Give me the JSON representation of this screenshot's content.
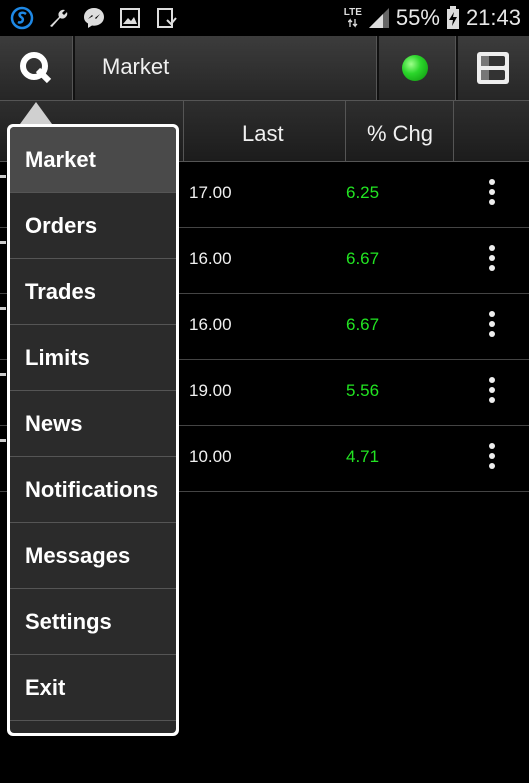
{
  "status_bar": {
    "network": "LTE",
    "battery": "55%",
    "time": "21:43",
    "left_icons": [
      "s-logo-icon",
      "wrench-icon",
      "messenger-icon",
      "gallery-icon",
      "download-icon"
    ]
  },
  "toolbar": {
    "title": "Market",
    "connection_color": "#2bd62b"
  },
  "table": {
    "headers": [
      "Last",
      "% Chg"
    ],
    "rows": [
      {
        "last": "17.00",
        "chg": "6.25"
      },
      {
        "last": "16.00",
        "chg": "6.67"
      },
      {
        "last": "16.00",
        "chg": "6.67"
      },
      {
        "last": "19.00",
        "chg": "5.56"
      },
      {
        "last": "10.00",
        "chg": "4.71"
      }
    ]
  },
  "menu": {
    "items": [
      "Market",
      "Orders",
      "Trades",
      "Limits",
      "News",
      "Notifications",
      "Messages",
      "Settings",
      "Exit"
    ],
    "active": "Market"
  },
  "colors": {
    "positive": "#22e422",
    "accent": "#1e88e5"
  }
}
